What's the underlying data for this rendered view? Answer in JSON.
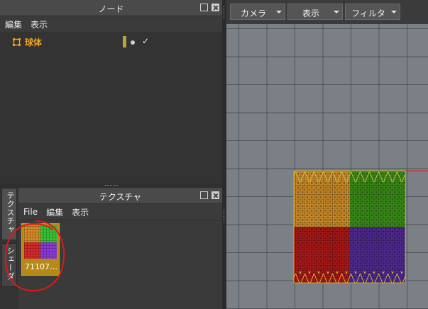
{
  "node_panel": {
    "title": "ノード",
    "menu": [
      "編集",
      "表示"
    ],
    "items": [
      {
        "label": "球体",
        "icon": "mesh-node-icon"
      }
    ],
    "check": "✓"
  },
  "texture_panel": {
    "title": "テクスチャ",
    "menu": [
      "File",
      "編集",
      "表示"
    ],
    "items": [
      {
        "label": "71107…",
        "icon": "texture-thumbnail"
      }
    ]
  },
  "side_tabs": [
    "テクスチャ",
    "シェーダ"
  ],
  "toolbar": {
    "camera": "カメラ",
    "display": "表示",
    "filter": "フィルタ"
  },
  "colors": {
    "selected_item": "#f0a020",
    "thumb_bg": "#b58a18",
    "viewport_bg": "#7b7f86",
    "annotation": "#e01818",
    "quad_orange": "#d08a2a",
    "quad_green": "#3a9a1a",
    "quad_red": "#b01818",
    "quad_purple": "#5a2a9a"
  }
}
